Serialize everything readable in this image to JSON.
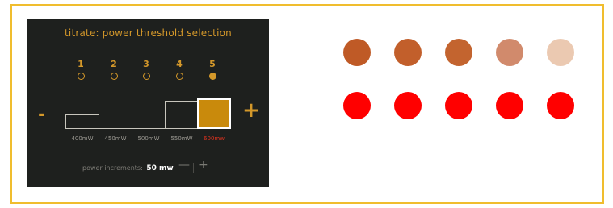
{
  "panel": {
    "title": "titrate: power threshold selection",
    "levels": [
      {
        "number": "1",
        "selected": false
      },
      {
        "number": "2",
        "selected": false
      },
      {
        "number": "3",
        "selected": false
      },
      {
        "number": "4",
        "selected": false
      },
      {
        "number": "5",
        "selected": true
      }
    ],
    "minus_label": "-",
    "plus_label": "+",
    "bars": [
      {
        "label": "400mW",
        "selected": false
      },
      {
        "label": "450mW",
        "selected": false
      },
      {
        "label": "500mW",
        "selected": false
      },
      {
        "label": "550mW",
        "selected": false
      },
      {
        "label": "600mw",
        "selected": true
      }
    ],
    "increment": {
      "label": "power increments:",
      "value": "50 mw",
      "minus": "—",
      "plus": "+"
    }
  },
  "swatches": {
    "tone_colors": [
      "#bf5a26",
      "#c25f2b",
      "#c3642f",
      "#d18a6c",
      "#ebc9b1"
    ],
    "target_colors": [
      "#ff0000",
      "#ff0000",
      "#ff0000",
      "#ff0000",
      "#ff0000"
    ]
  },
  "colors": {
    "accent": "#d4982a",
    "frame_border": "#f0bd2e",
    "panel_background": "#1e201e",
    "selected_bar": "#c98a0c",
    "selected_label": "#e0321e"
  }
}
